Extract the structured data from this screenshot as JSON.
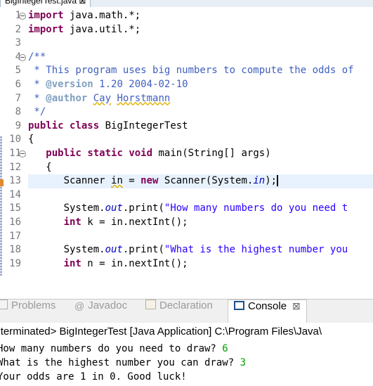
{
  "editor": {
    "tab_label": "BigIntegerTest.java ⊠",
    "line_numbers": [
      "1",
      "2",
      "3",
      "4",
      "5",
      "6",
      "7",
      "8",
      "9",
      "10",
      "11",
      "12",
      "13",
      "14",
      "15",
      "16",
      "17",
      "18",
      "19"
    ],
    "code": {
      "l1_kw": "import",
      "l1_rest": " java.math.*;",
      "l2_kw": "import",
      "l2_rest": " java.util.*;",
      "l4": "/**",
      "l5": " * This program uses big numbers to compute the odds of",
      "l6_pre": " * ",
      "l6_tag": "@version",
      "l6_rest": " 1.20 2004-02-10",
      "l7_pre": " * ",
      "l7_tag": "@author",
      "l7_sp": " ",
      "l7_a": "Cay",
      "l7_sp2": " ",
      "l7_b": "Horstmann",
      "l8": " */",
      "l9_kw1": "public",
      "l9_sp": " ",
      "l9_kw2": "class",
      "l9_rest": " BigIntegerTest",
      "l10": "{",
      "l11_indent": "   ",
      "l11_kw1": "public",
      "l11_kw2": "static",
      "l11_kw3": "void",
      "l11_rest": " main(String[] args)",
      "l12": "   {",
      "l13_a": "      Scanner ",
      "l13_in": "in",
      "l13_b": " = ",
      "l13_kw": "new",
      "l13_c": " Scanner(System.",
      "l13_fld": "in",
      "l13_d": ");",
      "l15_a": "      System.",
      "l15_fld": "out",
      "l15_b": ".print(",
      "l15_str": "\"How many numbers do you need t",
      "l16_indent": "      ",
      "l16_kw": "int",
      "l16_rest": " k = in.nextInt();",
      "l18_a": "      System.",
      "l18_fld": "out",
      "l18_b": ".print(",
      "l18_str": "\"What is the highest number you",
      "l19_indent": "      ",
      "l19_kw": "int",
      "l19_rest": " n = in.nextInt();"
    },
    "scroll_left_arrow": "<"
  },
  "views": {
    "tabs": [
      {
        "label": "Problems",
        "icon": "problems-icon"
      },
      {
        "label": "Javadoc",
        "icon": "at-sign-icon",
        "glyph": "@"
      },
      {
        "label": "Declaration",
        "icon": "declaration-icon"
      },
      {
        "label": "Console",
        "icon": "console-icon",
        "active": true,
        "close": "⊠"
      }
    ]
  },
  "console": {
    "header": "<terminated> BigIntegerTest [Java Application] C:\\Program Files\\Java\\",
    "lines": [
      {
        "prompt": "How many numbers do you need to draw? ",
        "input": "6"
      },
      {
        "prompt": "What is the highest number you can draw? ",
        "input": "3"
      },
      {
        "prompt": "Your odds are 1 in 0. Good luck!",
        "input": ""
      }
    ]
  },
  "colors": {
    "keyword": "#7f0055",
    "comment": "#3f5fbf",
    "string": "#2a00ff",
    "field": "#0000c0",
    "console_input": "#00a000"
  }
}
